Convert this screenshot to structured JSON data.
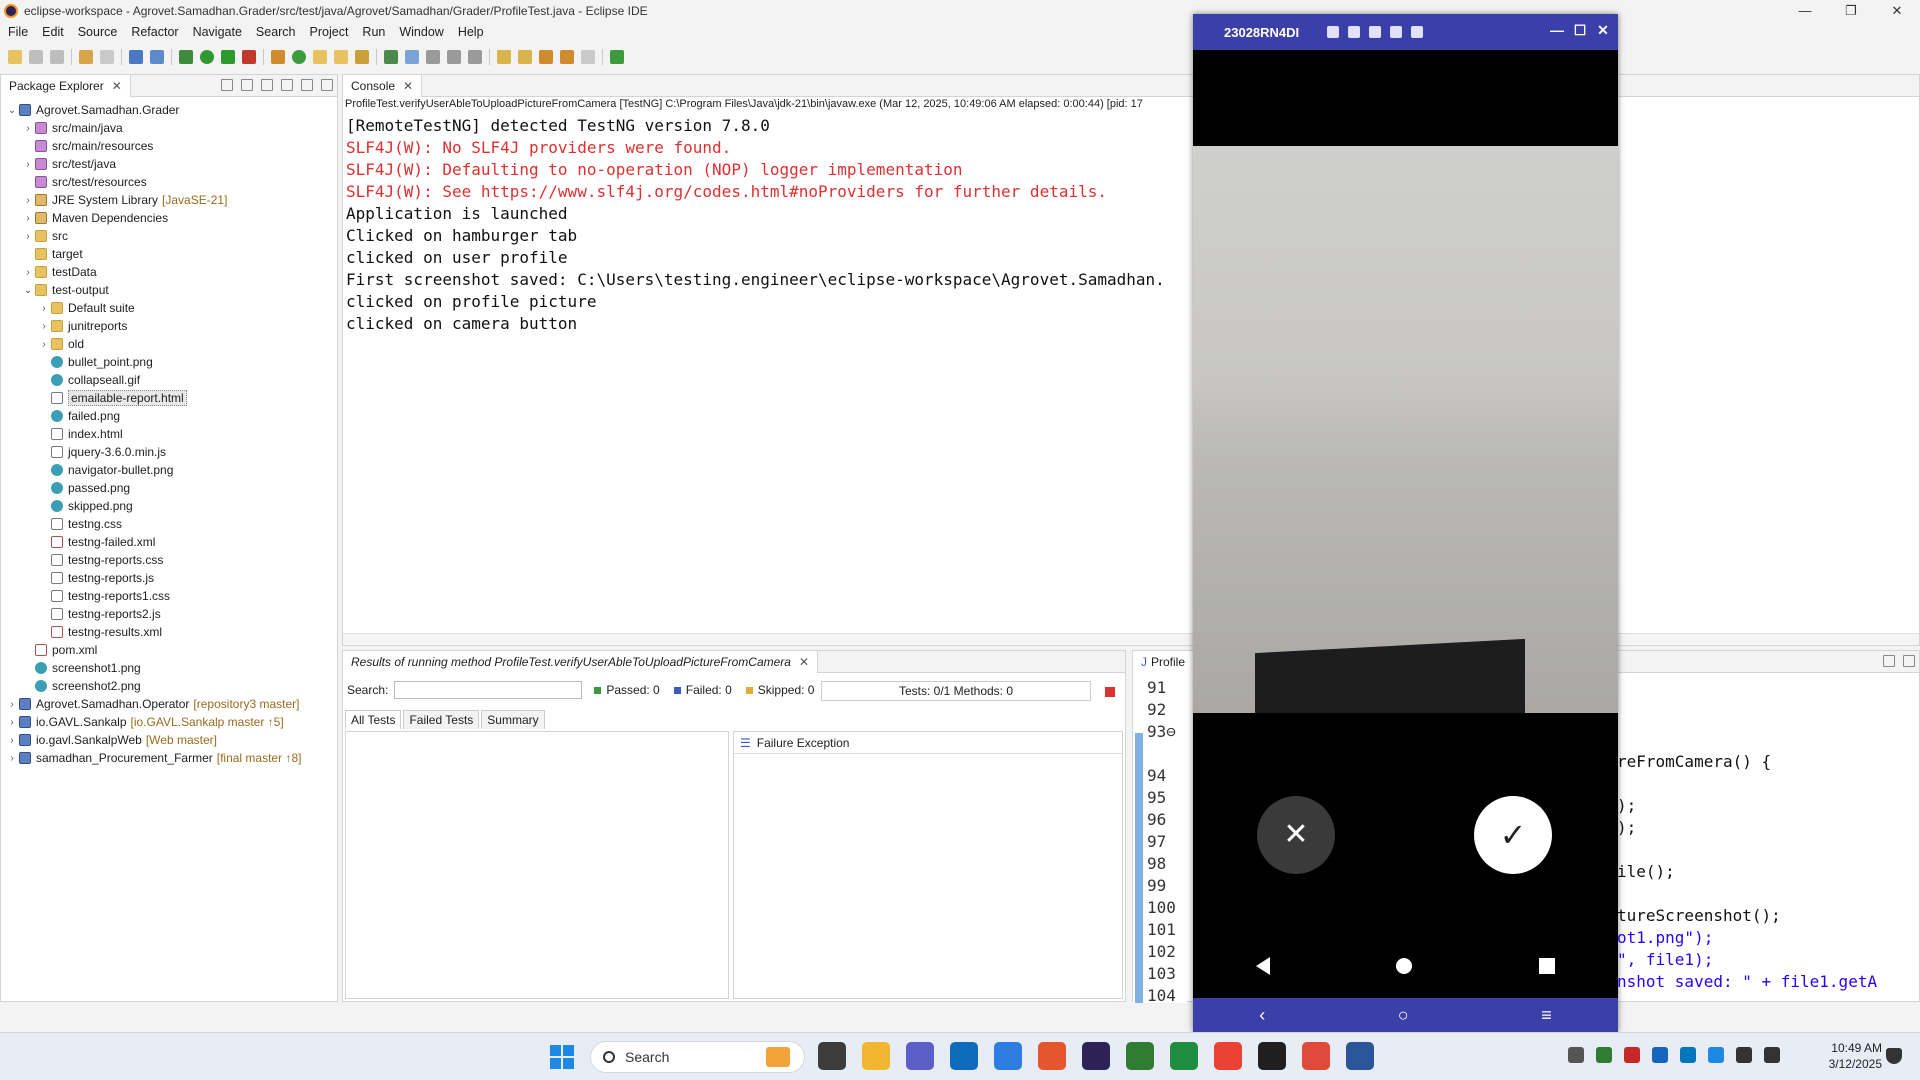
{
  "window": {
    "title": "eclipse-workspace - Agrovet.Samadhan.Grader/src/test/java/Agrovet/Samadhan/Grader/ProfileTest.java - Eclipse IDE",
    "controls": [
      "—",
      "❐",
      "✕"
    ]
  },
  "menu": [
    "File",
    "Edit",
    "Source",
    "Refactor",
    "Navigate",
    "Search",
    "Project",
    "Run",
    "Window",
    "Help"
  ],
  "package_explorer": {
    "tab_label": "Package Explorer",
    "tree": [
      {
        "label": "Agrovet.Samadhan.Grader",
        "deco": "",
        "arrow": "⌄",
        "indent": 0,
        "icon": "proj"
      },
      {
        "label": "src/main/java",
        "deco": "",
        "arrow": "›",
        "indent": 1,
        "icon": "pkgf"
      },
      {
        "label": "src/main/resources",
        "deco": "",
        "arrow": "",
        "indent": 1,
        "icon": "pkgf"
      },
      {
        "label": "src/test/java",
        "deco": "",
        "arrow": "›",
        "indent": 1,
        "icon": "pkgf"
      },
      {
        "label": "src/test/resources",
        "deco": "",
        "arrow": "",
        "indent": 1,
        "icon": "pkgf"
      },
      {
        "label": "JRE System Library",
        "deco": "[JavaSE-21]",
        "arrow": "›",
        "indent": 1,
        "icon": "lib"
      },
      {
        "label": "Maven Dependencies",
        "deco": "",
        "arrow": "›",
        "indent": 1,
        "icon": "lib"
      },
      {
        "label": "src",
        "deco": "",
        "arrow": "›",
        "indent": 1,
        "icon": "folder"
      },
      {
        "label": "target",
        "deco": "",
        "arrow": "",
        "indent": 1,
        "icon": "folder"
      },
      {
        "label": "testData",
        "deco": "",
        "arrow": "›",
        "indent": 1,
        "icon": "folder"
      },
      {
        "label": "test-output",
        "deco": "",
        "arrow": "⌄",
        "indent": 1,
        "icon": "folder"
      },
      {
        "label": "Default suite",
        "deco": "",
        "arrow": "›",
        "indent": 2,
        "icon": "folder"
      },
      {
        "label": "junitreports",
        "deco": "",
        "arrow": "›",
        "indent": 2,
        "icon": "folder"
      },
      {
        "label": "old",
        "deco": "",
        "arrow": "›",
        "indent": 2,
        "icon": "folder"
      },
      {
        "label": "bullet_point.png",
        "deco": "",
        "arrow": "",
        "indent": 2,
        "icon": "img"
      },
      {
        "label": "collapseall.gif",
        "deco": "",
        "arrow": "",
        "indent": 2,
        "icon": "img"
      },
      {
        "label": "emailable-report.html",
        "deco": "",
        "arrow": "",
        "indent": 2,
        "icon": "file",
        "selected": true
      },
      {
        "label": "failed.png",
        "deco": "",
        "arrow": "",
        "indent": 2,
        "icon": "img"
      },
      {
        "label": "index.html",
        "deco": "",
        "arrow": "",
        "indent": 2,
        "icon": "file"
      },
      {
        "label": "jquery-3.6.0.min.js",
        "deco": "",
        "arrow": "",
        "indent": 2,
        "icon": "file"
      },
      {
        "label": "navigator-bullet.png",
        "deco": "",
        "arrow": "",
        "indent": 2,
        "icon": "img"
      },
      {
        "label": "passed.png",
        "deco": "",
        "arrow": "",
        "indent": 2,
        "icon": "img"
      },
      {
        "label": "skipped.png",
        "deco": "",
        "arrow": "",
        "indent": 2,
        "icon": "img"
      },
      {
        "label": "testng.css",
        "deco": "",
        "arrow": "",
        "indent": 2,
        "icon": "file"
      },
      {
        "label": "testng-failed.xml",
        "deco": "",
        "arrow": "",
        "indent": 2,
        "icon": "xml"
      },
      {
        "label": "testng-reports.css",
        "deco": "",
        "arrow": "",
        "indent": 2,
        "icon": "file"
      },
      {
        "label": "testng-reports.js",
        "deco": "",
        "arrow": "",
        "indent": 2,
        "icon": "file"
      },
      {
        "label": "testng-reports1.css",
        "deco": "",
        "arrow": "",
        "indent": 2,
        "icon": "file"
      },
      {
        "label": "testng-reports2.js",
        "deco": "",
        "arrow": "",
        "indent": 2,
        "icon": "file"
      },
      {
        "label": "testng-results.xml",
        "deco": "",
        "arrow": "",
        "indent": 2,
        "icon": "xml"
      },
      {
        "label": "pom.xml",
        "deco": "",
        "arrow": "",
        "indent": 1,
        "icon": "xml"
      },
      {
        "label": "screenshot1.png",
        "deco": "",
        "arrow": "",
        "indent": 1,
        "icon": "img"
      },
      {
        "label": "screenshot2.png",
        "deco": "",
        "arrow": "",
        "indent": 1,
        "icon": "img"
      },
      {
        "label": "Agrovet.Samadhan.Operator",
        "deco": "[repository3 master]",
        "arrow": "›",
        "indent": 0,
        "icon": "proj"
      },
      {
        "label": "io.GAVL.Sankalp",
        "deco": "[io.GAVL.Sankalp master ↑5]",
        "arrow": "›",
        "indent": 0,
        "icon": "proj"
      },
      {
        "label": "io.gavl.SankalpWeb",
        "deco": "[Web master]",
        "arrow": "›",
        "indent": 0,
        "icon": "proj"
      },
      {
        "label": "samadhan_Procurement_Farmer",
        "deco": "[final master ↑8]",
        "arrow": "›",
        "indent": 0,
        "icon": "proj"
      }
    ]
  },
  "console": {
    "tab_label": "Console",
    "header": "ProfileTest.verifyUserAbleToUploadPictureFromCamera [TestNG] C:\\Program Files\\Java\\jdk-21\\bin\\javaw.exe  (Mar 12, 2025, 10:49:06 AM elapsed: 0:00:44) [pid: 17",
    "lines": [
      {
        "text": "[RemoteTestNG] detected TestNG version 7.8.0",
        "error": false
      },
      {
        "text": "SLF4J(W): No SLF4J providers were found.",
        "error": true
      },
      {
        "text": "SLF4J(W): Defaulting to no-operation (NOP) logger implementation",
        "error": true
      },
      {
        "text": "SLF4J(W): See https://www.slf4j.org/codes.html#noProviders for further details.",
        "error": true
      },
      {
        "text": "Application is launched",
        "error": false
      },
      {
        "text": "Clicked on hamburger tab",
        "error": false
      },
      {
        "text": "clicked on user profile",
        "error": false
      },
      {
        "text": "First screenshot saved: C:\\Users\\testing.engineer\\eclipse-workspace\\Agrovet.Samadhan.",
        "error": false
      },
      {
        "text": "clicked on profile picture",
        "error": false
      },
      {
        "text": "clicked on camera button",
        "error": false
      }
    ]
  },
  "testng": {
    "tab_label": "Results of running method ProfileTest.verifyUserAbleToUploadPictureFromCamera",
    "search_label": "Search:",
    "passed": "Passed: 0",
    "failed": "Failed: 0",
    "skipped": "Skipped: 0",
    "progress_text": "Tests: 0/1  Methods: 0",
    "tabs": [
      "All Tests",
      "Failed Tests",
      "Summary"
    ],
    "failure_header": "Failure Exception"
  },
  "editor": {
    "tab_label": "Profile",
    "line_numbers": [
      "91",
      "92",
      "93⊖",
      "",
      "94",
      "95",
      "96",
      "97",
      "98",
      "99",
      "100",
      "101",
      "102",
      "103",
      "104"
    ],
    "code_lines": [
      {
        "text": "reFromCamera() {",
        "str": ""
      },
      {
        "text": "",
        "str": ""
      },
      {
        "text": ");",
        "str": ""
      },
      {
        "text": ");",
        "str": ""
      },
      {
        "text": "",
        "str": ""
      },
      {
        "text": "ile();",
        "str": ""
      },
      {
        "text": "",
        "str": ""
      },
      {
        "text": "tureScreenshot();",
        "str": ""
      },
      {
        "text": "",
        "str": "ot1.png\");"
      },
      {
        "text": "",
        "str": "\", file1);"
      },
      {
        "text": "",
        "str": "nshot saved: \" + file1.getA"
      }
    ]
  },
  "phone": {
    "device_name": "23028RN4DI",
    "cancel_glyph": "✕",
    "ok_glyph": "✓",
    "bottom_glyphs": [
      "‹",
      "○",
      "≡"
    ]
  },
  "taskbar": {
    "search_placeholder": "Search",
    "time": "10:49 AM",
    "date": "3/12/2025",
    "app_colors": [
      "#3c3c3c",
      "#f2b731",
      "#5b5fc7",
      "#0f6cbd",
      "#2f7de1",
      "#e4572e",
      "#2c2255",
      "#2e7d32",
      "#1e8e3e",
      "#ea4335",
      "#1f1f1f",
      "#e04a3a",
      "#2b579a"
    ]
  },
  "colors": {
    "console_error": "#e03030",
    "phone_titlebar": "#3b3fa8",
    "accent_blue": "#7fb2e5"
  }
}
